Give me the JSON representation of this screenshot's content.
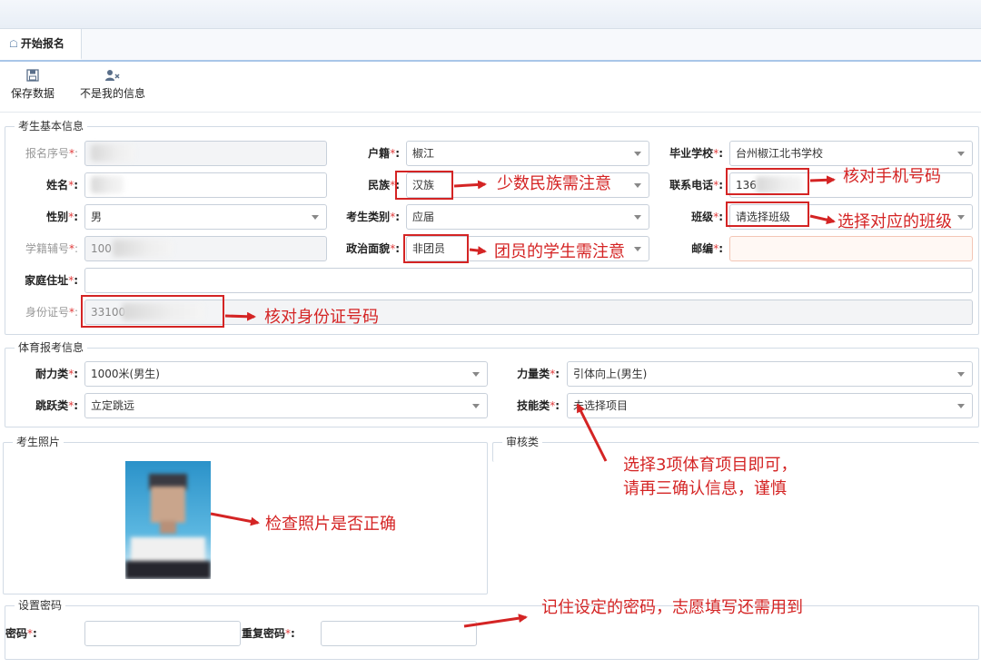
{
  "tab": {
    "label": "开始报名"
  },
  "toolbar": {
    "save_label": "保存数据",
    "not_mine_label": "不是我的信息"
  },
  "basic": {
    "legend": "考生基本信息",
    "reg_no_label": "报名序号",
    "huji_label": "户籍",
    "huji_value": "椒江",
    "school_label": "毕业学校",
    "school_value": "台州椒江北书学校",
    "name_label": "姓名",
    "minzu_label": "民族",
    "minzu_value": "汉族",
    "phone_label": "联系电话",
    "phone_value": "136",
    "gender_label": "性别",
    "gender_value": "男",
    "type_label": "考生类别",
    "type_value": "应届",
    "class_label": "班级",
    "class_value": "请选择班级",
    "xueji_label": "学籍辅号",
    "xueji_value": "100",
    "politics_label": "政治面貌",
    "politics_value": "非团员",
    "postcode_label": "邮编",
    "address_label": "家庭住址",
    "idcard_label": "身份证号",
    "idcard_value": "33100"
  },
  "sports": {
    "legend": "体育报考信息",
    "endurance_label": "耐力类",
    "endurance_value": "1000米(男生)",
    "strength_label": "力量类",
    "strength_value": "引体向上(男生)",
    "jump_label": "跳跃类",
    "jump_value": "立定跳远",
    "skill_label": "技能类",
    "skill_value": "未选择项目"
  },
  "photo": {
    "legend": "考生照片"
  },
  "review": {
    "legend": "审核类"
  },
  "password": {
    "legend": "设置密码",
    "pwd_label": "密码",
    "repeat_label": "重复密码"
  },
  "annotations": {
    "minzu": "少数民族需注意",
    "phone": "核对手机号码",
    "class": "选择对应的班级",
    "politics": "团员的学生需注意",
    "idcard": "核对身份证号码",
    "sports_line1": "选择3项体育项目即可，",
    "sports_line2": "请再三确认信息，谨慎",
    "photo": "检查照片是否正确",
    "password": "记住设定的密码，志愿填写还需用到"
  },
  "colors": {
    "accent": "#a9c6e8",
    "annotation_red": "#d42424",
    "required_star": "#e03a3a"
  },
  "icons": {
    "tab": "home-icon",
    "save": "floppy-disk-icon",
    "not_mine": "user-remove-icon"
  }
}
